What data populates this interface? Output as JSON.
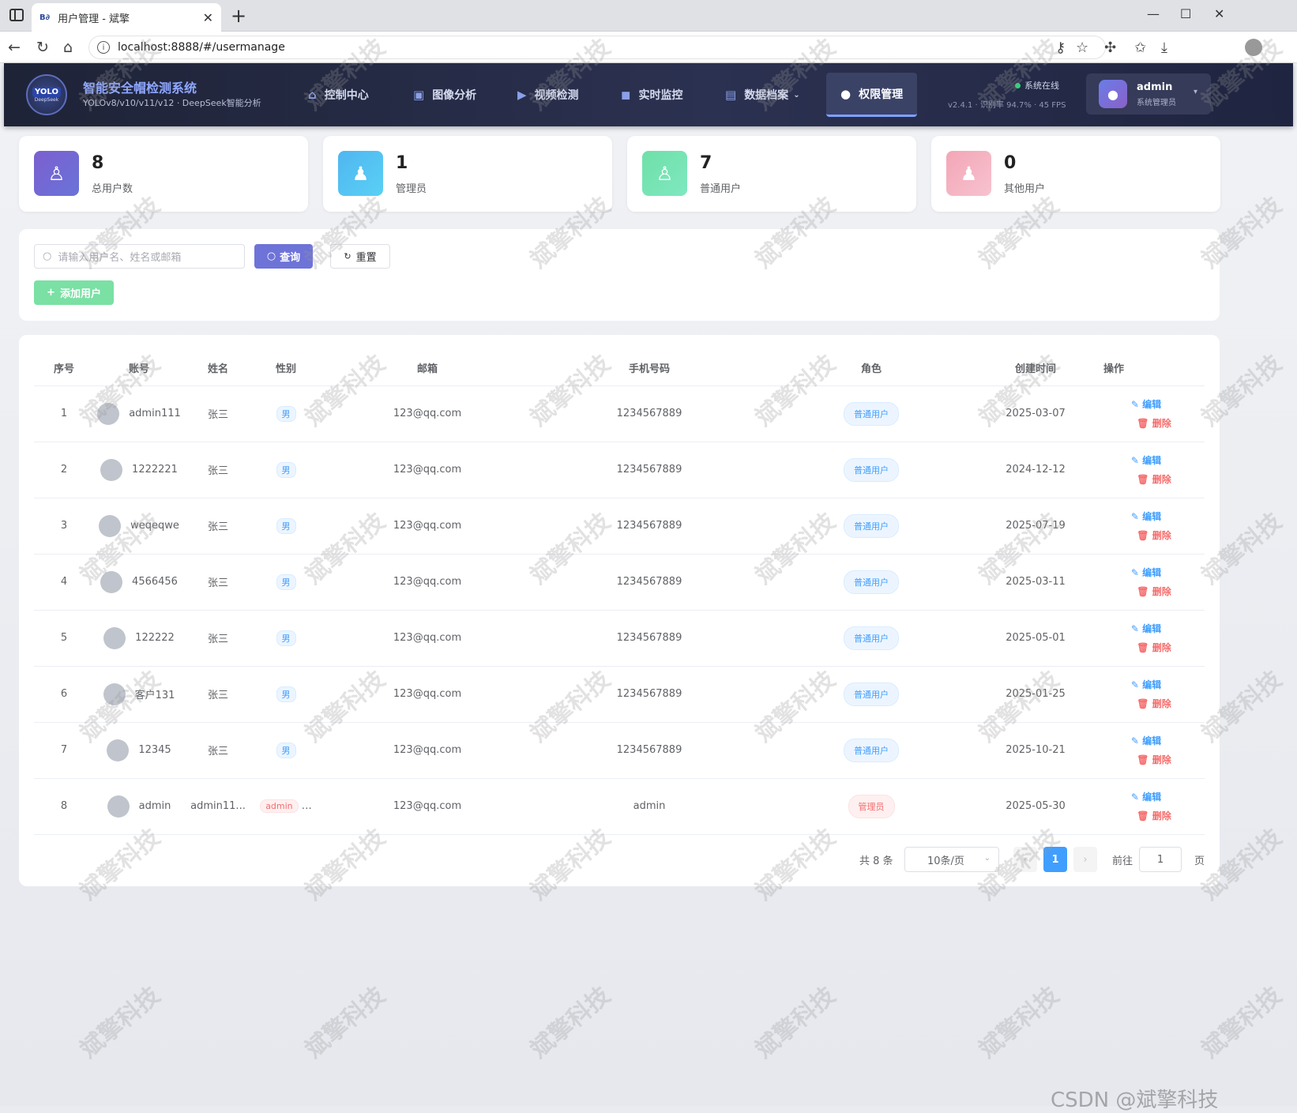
{
  "browser": {
    "tab_title": "用户管理 - 斌擎",
    "favicon_text": "B∂",
    "url": "localhost:8888/#/usermanage"
  },
  "header": {
    "logo_top": "YOLO",
    "logo_bottom": "DeepSeek",
    "title": "智能安全帽检测系统",
    "subtitle": "YOLOv8/v10/v11/v12 · DeepSeek智能分析",
    "nav": [
      {
        "label": "控制中心",
        "icon": "home-icon"
      },
      {
        "label": "图像分析",
        "icon": "image-icon"
      },
      {
        "label": "视频检测",
        "icon": "video-icon"
      },
      {
        "label": "实时监控",
        "icon": "camera-icon"
      },
      {
        "label": "数据档案",
        "icon": "file-icon"
      },
      {
        "label": "权限管理",
        "icon": "user-icon"
      }
    ],
    "status": "系统在线",
    "version_info": "v2.4.1 · 识别率 94.7% · 45 FPS",
    "user_name": "admin",
    "user_role": "系统管理员"
  },
  "stats": [
    {
      "value": "8",
      "label": "总用户数",
      "color": "#7b5fcf"
    },
    {
      "value": "1",
      "label": "管理员",
      "color": "#4fb6f0"
    },
    {
      "value": "7",
      "label": "普通用户",
      "color": "#6fe0a8"
    },
    {
      "value": "0",
      "label": "其他用户",
      "color": "#f3a6b6"
    }
  ],
  "search": {
    "placeholder": "请输入用户名、姓名或邮箱",
    "query_label": "查询",
    "reset_label": "重置",
    "add_label": "添加用户"
  },
  "table": {
    "columns": [
      "序号",
      "账号",
      "姓名",
      "性别",
      "邮箱",
      "手机号码",
      "角色",
      "创建时间",
      "操作"
    ],
    "edit_label": "编辑",
    "delete_label": "删除",
    "rows": [
      {
        "no": "1",
        "account": "admin111",
        "name": "张三",
        "gender": "男",
        "email": "123@qq.com",
        "phone": "1234567889",
        "role": "普通用户",
        "created": "2025-03-07"
      },
      {
        "no": "2",
        "account": "1222221",
        "name": "张三",
        "gender": "男",
        "email": "123@qq.com",
        "phone": "1234567889",
        "role": "普通用户",
        "created": "2024-12-12"
      },
      {
        "no": "3",
        "account": "weqeqwe",
        "name": "张三",
        "gender": "男",
        "email": "123@qq.com",
        "phone": "1234567889",
        "role": "普通用户",
        "created": "2025-07-19"
      },
      {
        "no": "4",
        "account": "4566456",
        "name": "张三",
        "gender": "男",
        "email": "123@qq.com",
        "phone": "1234567889",
        "role": "普通用户",
        "created": "2025-03-11"
      },
      {
        "no": "5",
        "account": "122222",
        "name": "张三",
        "gender": "男",
        "email": "123@qq.com",
        "phone": "1234567889",
        "role": "普通用户",
        "created": "2025-05-01"
      },
      {
        "no": "6",
        "account": "客户131",
        "name": "张三",
        "gender": "男",
        "email": "123@qq.com",
        "phone": "1234567889",
        "role": "普通用户",
        "created": "2025-01-25"
      },
      {
        "no": "7",
        "account": "12345",
        "name": "张三",
        "gender": "男",
        "email": "123@qq.com",
        "phone": "1234567889",
        "role": "普通用户",
        "created": "2025-10-21"
      },
      {
        "no": "8",
        "account": "admin",
        "name": "admin11...",
        "gender": "admin",
        "email": "123@qq.com",
        "phone": "admin",
        "role": "管理员",
        "created": "2025-05-30"
      }
    ]
  },
  "pager": {
    "total": "共 8 条",
    "size": "10条/页",
    "current": "1",
    "goto": "前往",
    "goto_value": "1",
    "page_unit": "页"
  },
  "watermark": "斌擎科技",
  "csdn": "CSDN @斌擎科技"
}
